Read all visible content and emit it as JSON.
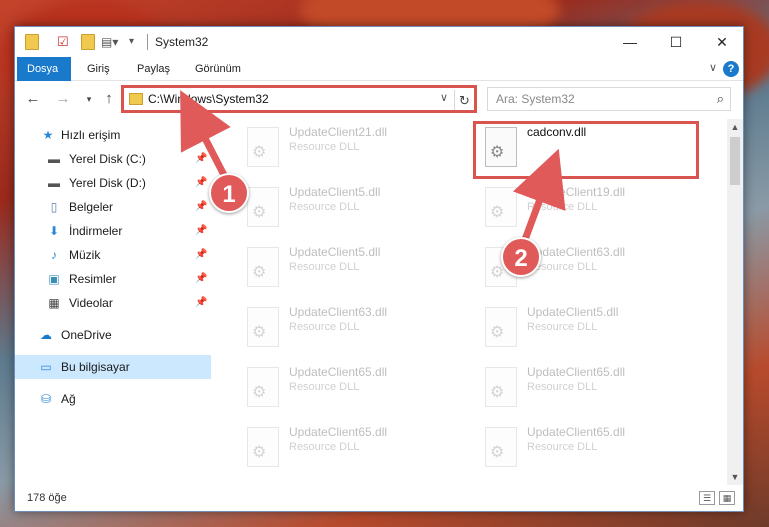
{
  "window": {
    "title": "System32",
    "controls": {
      "minimize": "—",
      "maximize": "☐",
      "close": "✕"
    }
  },
  "ribbon": {
    "tabs": [
      {
        "label": "Dosya",
        "active": true
      },
      {
        "label": "Giriş",
        "active": false
      },
      {
        "label": "Paylaş",
        "active": false
      },
      {
        "label": "Görünüm",
        "active": false
      }
    ],
    "help": "?"
  },
  "address": {
    "path": "C:\\Windows\\System32",
    "search_placeholder": "Ara: System32"
  },
  "nav": {
    "items": [
      {
        "label": "Hızlı erişim",
        "icon": "star-icon",
        "pinned": false
      },
      {
        "label": "Yerel Disk (C:)",
        "icon": "drive-icon",
        "pinned": true
      },
      {
        "label": "Yerel Disk (D:)",
        "icon": "drive-icon",
        "pinned": true
      },
      {
        "label": "Belgeler",
        "icon": "documents-icon",
        "pinned": true
      },
      {
        "label": "İndirmeler",
        "icon": "download-icon",
        "pinned": true
      },
      {
        "label": "Müzik",
        "icon": "music-icon",
        "pinned": true
      },
      {
        "label": "Resimler",
        "icon": "pictures-icon",
        "pinned": true
      },
      {
        "label": "Videolar",
        "icon": "videos-icon",
        "pinned": true
      },
      {
        "label": "OneDrive",
        "icon": "cloud-icon",
        "pinned": false
      },
      {
        "label": "Bu bilgisayar",
        "icon": "computer-icon",
        "pinned": false,
        "selected": true
      },
      {
        "label": "Ağ",
        "icon": "network-icon",
        "pinned": false
      }
    ]
  },
  "files": [
    {
      "name": "UpdateClient21.dll",
      "type": "Resource DLL"
    },
    {
      "name": "cadconv.dll",
      "type": "",
      "highlighted": true
    },
    {
      "name": "UpdateClient5.dll",
      "type": "Resource DLL"
    },
    {
      "name": "UpdateClient19.dll",
      "type": "Resource DLL"
    },
    {
      "name": "UpdateClient5.dll",
      "type": "Resource DLL"
    },
    {
      "name": "UpdateClient63.dll",
      "type": "Resource DLL"
    },
    {
      "name": "UpdateClient63.dll",
      "type": "Resource DLL"
    },
    {
      "name": "UpdateClient5.dll",
      "type": "Resource DLL"
    },
    {
      "name": "UpdateClient65.dll",
      "type": "Resource DLL"
    },
    {
      "name": "UpdateClient65.dll",
      "type": "Resource DLL"
    },
    {
      "name": "UpdateClient65.dll",
      "type": "Resource DLL"
    },
    {
      "name": "UpdateClient65.dll",
      "type": "Resource DLL"
    }
  ],
  "status": {
    "count": "178 öğe"
  },
  "annotations": [
    {
      "number": "1"
    },
    {
      "number": "2"
    }
  ],
  "colors": {
    "accent": "#1979ca",
    "highlight": "#d9534f",
    "badge": "#e05a5a"
  }
}
